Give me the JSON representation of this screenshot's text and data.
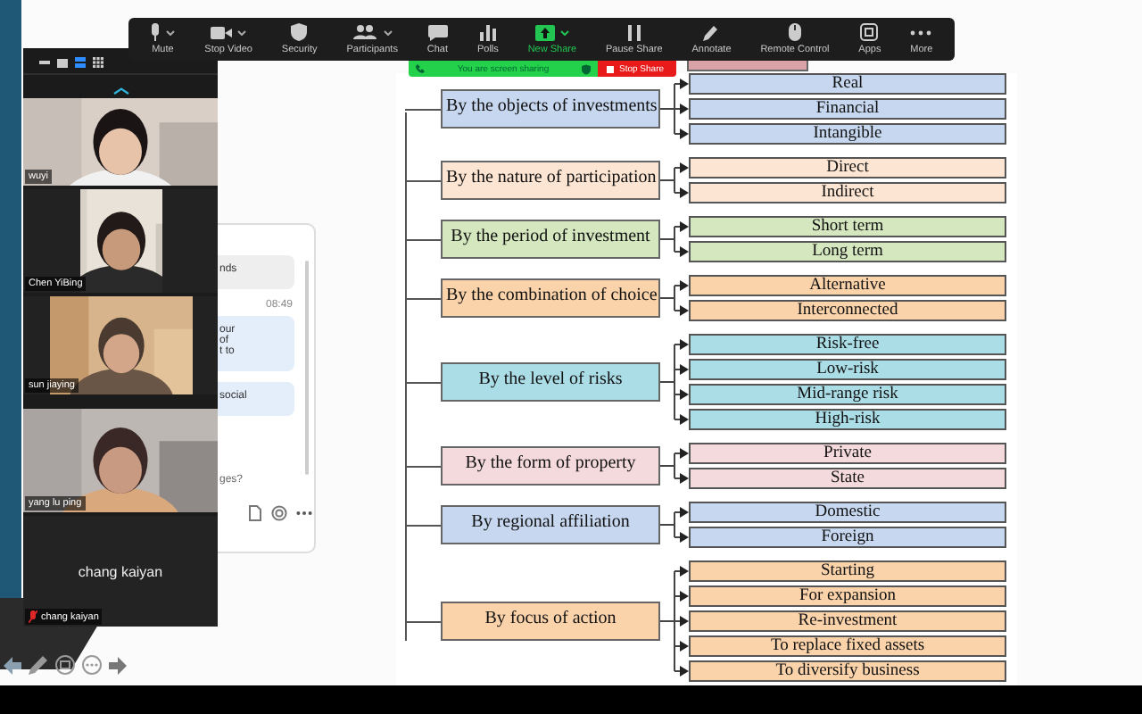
{
  "toolbar": {
    "items": [
      {
        "label": "Mute",
        "kind": "mic",
        "menu": true,
        "highlighted": false
      },
      {
        "label": "Stop Video",
        "kind": "video",
        "menu": true,
        "highlighted": false
      },
      {
        "label": "Security",
        "kind": "shield",
        "menu": false,
        "highlighted": false
      },
      {
        "label": "Participants",
        "kind": "people",
        "menu": true,
        "highlighted": false
      },
      {
        "label": "Chat",
        "kind": "chat",
        "menu": false,
        "highlighted": false
      },
      {
        "label": "Polls",
        "kind": "polls",
        "menu": false,
        "highlighted": false
      },
      {
        "label": "New Share",
        "kind": "share",
        "menu": true,
        "highlighted": true
      },
      {
        "label": "Pause Share",
        "kind": "pause",
        "menu": false,
        "highlighted": false
      },
      {
        "label": "Annotate",
        "kind": "pencil",
        "menu": false,
        "highlighted": false
      },
      {
        "label": "Remote Control",
        "kind": "mouse",
        "menu": false,
        "highlighted": false
      },
      {
        "label": "Apps",
        "kind": "apps",
        "menu": false,
        "highlighted": false
      },
      {
        "label": "More",
        "kind": "more",
        "menu": false,
        "highlighted": false
      }
    ]
  },
  "sharing_bar": {
    "status": "You are screen sharing",
    "stop_button": "Stop Share"
  },
  "video_panel": {
    "tiles": [
      {
        "name": "wuyi",
        "kind": "video",
        "muted": false
      },
      {
        "name": "Chen YiBing",
        "kind": "video",
        "muted": false
      },
      {
        "name": "sun jiaying",
        "kind": "video",
        "muted": false
      },
      {
        "name": "yang lu ping",
        "kind": "video",
        "muted": false
      },
      {
        "name": "chang kaiyan",
        "kind": "avatar",
        "title": "chang kaiyan",
        "muted": true
      }
    ]
  },
  "chat": {
    "messages": [
      {
        "lines": [
          "nds"
        ]
      },
      {
        "time": "08:49",
        "lines": [
          "our",
          "of",
          "t to"
        ]
      },
      {
        "lines": [
          "social"
        ]
      }
    ],
    "input": "ges?"
  },
  "diagram": {
    "groups": [
      {
        "label": "By the objects of investments",
        "color": "#c6d7ef",
        "children": [
          "Real",
          "Financial",
          "Intangible"
        ]
      },
      {
        "label": "By the nature of participation",
        "color": "#fde5d3",
        "children": [
          "Direct",
          "Indirect"
        ]
      },
      {
        "label": "By the period of investment",
        "color": "#d5e7bf",
        "children": [
          "Short term",
          "Long term"
        ]
      },
      {
        "label": "By the combination of choice",
        "color": "#fbd3ab",
        "children": [
          "Alternative",
          "Interconnected"
        ]
      },
      {
        "label": "By the level of risks",
        "color": "#abdde7",
        "children": [
          "Risk-free",
          "Low-risk",
          "Mid-range risk",
          "High-risk"
        ]
      },
      {
        "label": "By the form of property",
        "color": "#f4dadc",
        "children": [
          "Private",
          "State"
        ]
      },
      {
        "label": "By regional affiliation",
        "color": "#c6d7ef",
        "children": [
          "Domestic",
          "Foreign"
        ]
      },
      {
        "label": "By focus of action",
        "color": "#fbd3ab",
        "children": [
          "Starting",
          "For expansion",
          "Re-investment",
          "To replace fixed assets",
          "To diversify business"
        ]
      }
    ]
  }
}
